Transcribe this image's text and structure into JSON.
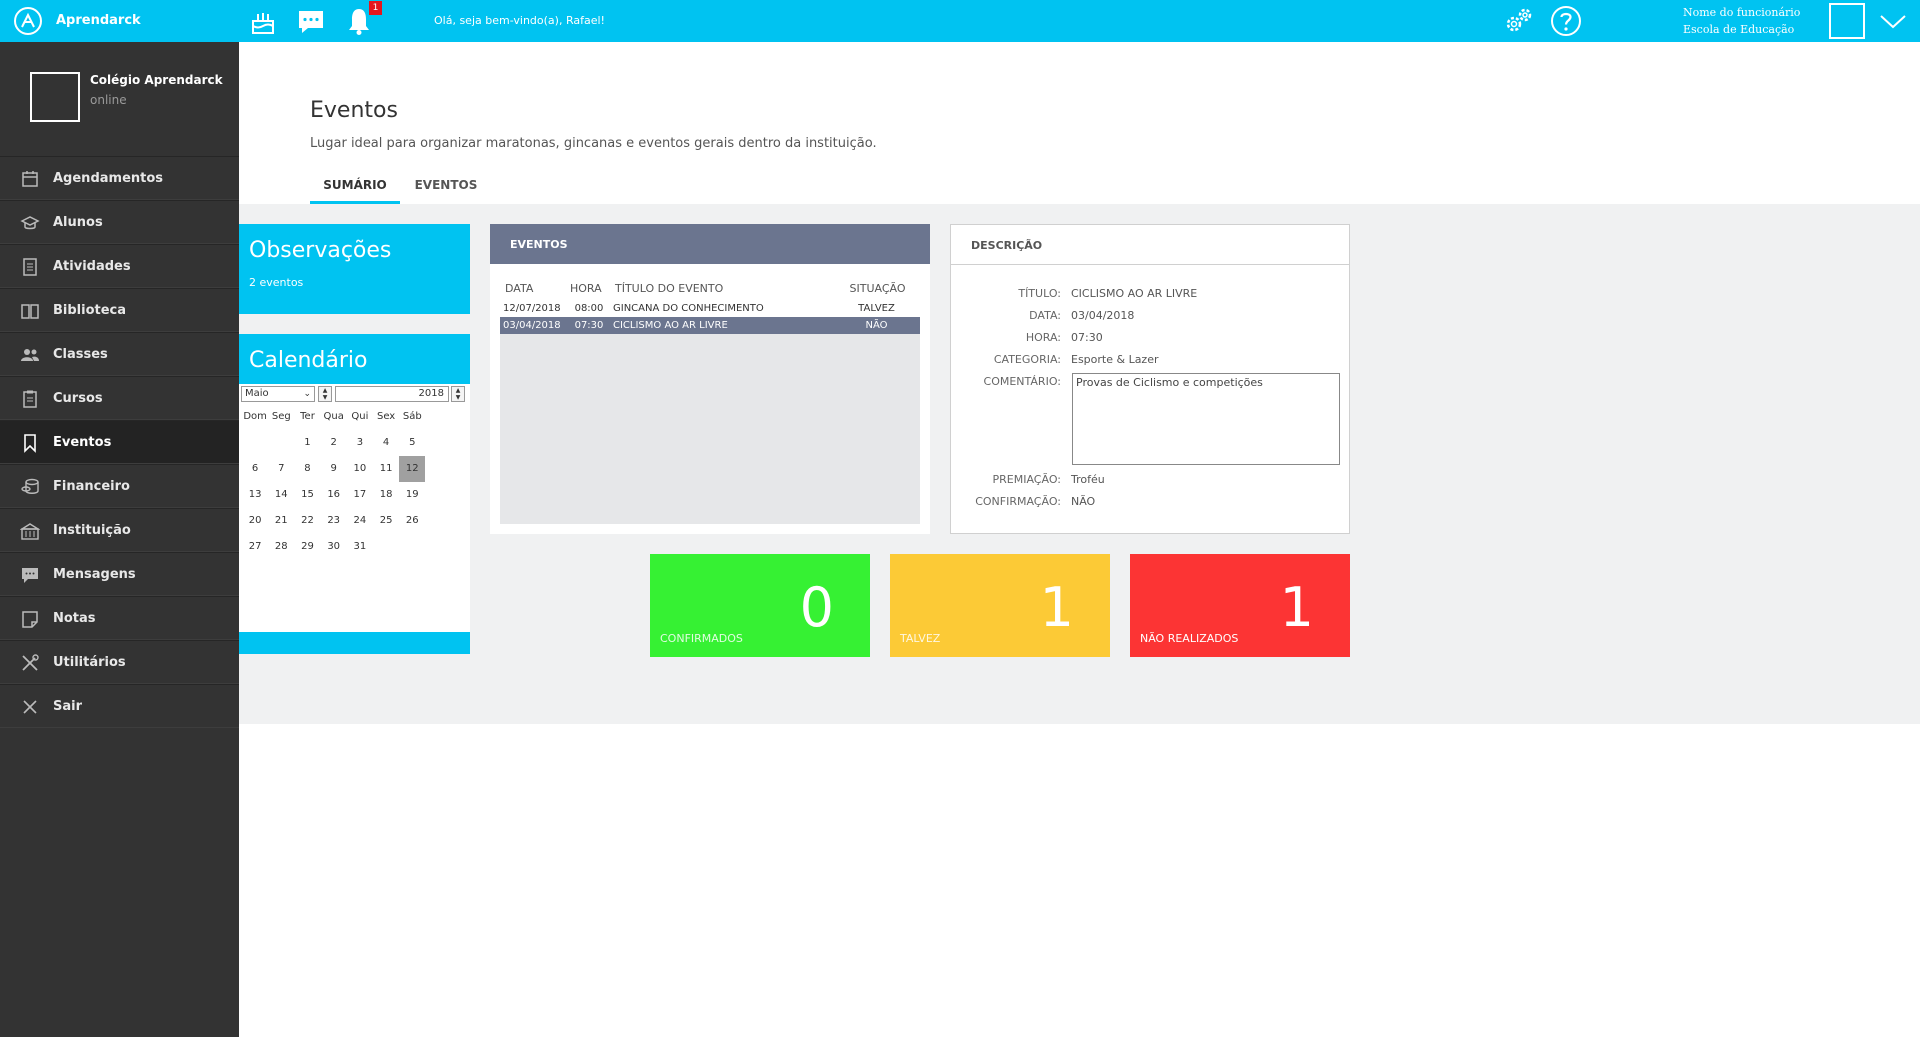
{
  "topbar": {
    "app_name": "Aprendarck",
    "notification_count": "1",
    "welcome": "Olá, seja bem-vindo(a), Rafael!",
    "user_name": "Nome do funcionário",
    "user_school": "Escola de Educação",
    "icons": [
      "logo-icon",
      "cake-icon",
      "chat-icon",
      "bell-icon",
      "gears-icon",
      "help-icon",
      "chevron-down-icon"
    ],
    "accent_color": "#00c3f1"
  },
  "sidebar": {
    "school": "Colégio Aprendarck",
    "status": "online",
    "items": [
      {
        "label": "Agendamentos",
        "icon": "calendar-icon"
      },
      {
        "label": "Alunos",
        "icon": "graduation-cap-icon"
      },
      {
        "label": "Atividades",
        "icon": "document-icon"
      },
      {
        "label": "Biblioteca",
        "icon": "book-icon"
      },
      {
        "label": "Classes",
        "icon": "users-icon"
      },
      {
        "label": "Cursos",
        "icon": "clipboard-icon"
      },
      {
        "label": "Eventos",
        "icon": "bookmark-icon",
        "active": true
      },
      {
        "label": "Financeiro",
        "icon": "coins-icon"
      },
      {
        "label": "Instituição",
        "icon": "building-icon"
      },
      {
        "label": "Mensagens",
        "icon": "message-icon"
      },
      {
        "label": "Notas",
        "icon": "note-icon"
      },
      {
        "label": "Utilitários",
        "icon": "tools-icon"
      },
      {
        "label": "Sair",
        "icon": "close-icon"
      }
    ]
  },
  "page": {
    "title": "Eventos",
    "subtitle": "Lugar ideal para organizar maratonas, gincanas e eventos gerais dentro da instituição.",
    "tabs": [
      {
        "label": "SUMÁRIO",
        "active": true
      },
      {
        "label": "EVENTOS",
        "active": false
      }
    ]
  },
  "observacoes": {
    "title": "Observações",
    "count": "2 eventos"
  },
  "calendar": {
    "title": "Calendário",
    "month": "Maio",
    "year": "2018",
    "weekdays": [
      "Dom",
      "Seg",
      "Ter",
      "Qua",
      "Qui",
      "Sex",
      "Sáb"
    ],
    "first_weekday": 2,
    "days_in_month": 31,
    "selected_day": 12
  },
  "eventos": {
    "header": "EVENTOS",
    "columns": [
      "DATA",
      "HORA",
      "TÍTULO DO EVENTO",
      "SITUAÇÃO"
    ],
    "rows": [
      {
        "data": "12/07/2018",
        "hora": "08:00",
        "titulo": "GINCANA DO CONHECIMENTO",
        "situacao": "TALVEZ",
        "selected": false
      },
      {
        "data": "03/04/2018",
        "hora": "07:30",
        "titulo": "CICLISMO AO AR LIVRE",
        "situacao": "NÃO",
        "selected": true
      }
    ]
  },
  "descricao": {
    "header": "DESCRIÇÃO",
    "titulo_label": "TÍTULO:",
    "titulo": "CICLISMO AO AR LIVRE",
    "data_label": "DATA:",
    "data": "03/04/2018",
    "hora_label": "HORA:",
    "hora": "07:30",
    "categoria_label": "CATEGORIA:",
    "categoria": "Esporte & Lazer",
    "comentario_label": "COMENTÁRIO:",
    "comentario": "Provas de Ciclismo e competições",
    "premiacao_label": "PREMIAÇÃO:",
    "premiacao": "Troféu",
    "confirmacao_label": "CONFIRMAÇÃO:",
    "confirmacao": "NÃO"
  },
  "stats": {
    "confirmados": {
      "value": "0",
      "label": "CONFIRMADOS",
      "color": "#36f133"
    },
    "talvez": {
      "value": "1",
      "label": "TALVEZ",
      "color": "#fcca36"
    },
    "nao_realizados": {
      "value": "1",
      "label": "NÃO REALIZADOS",
      "color": "#fc3434"
    }
  }
}
